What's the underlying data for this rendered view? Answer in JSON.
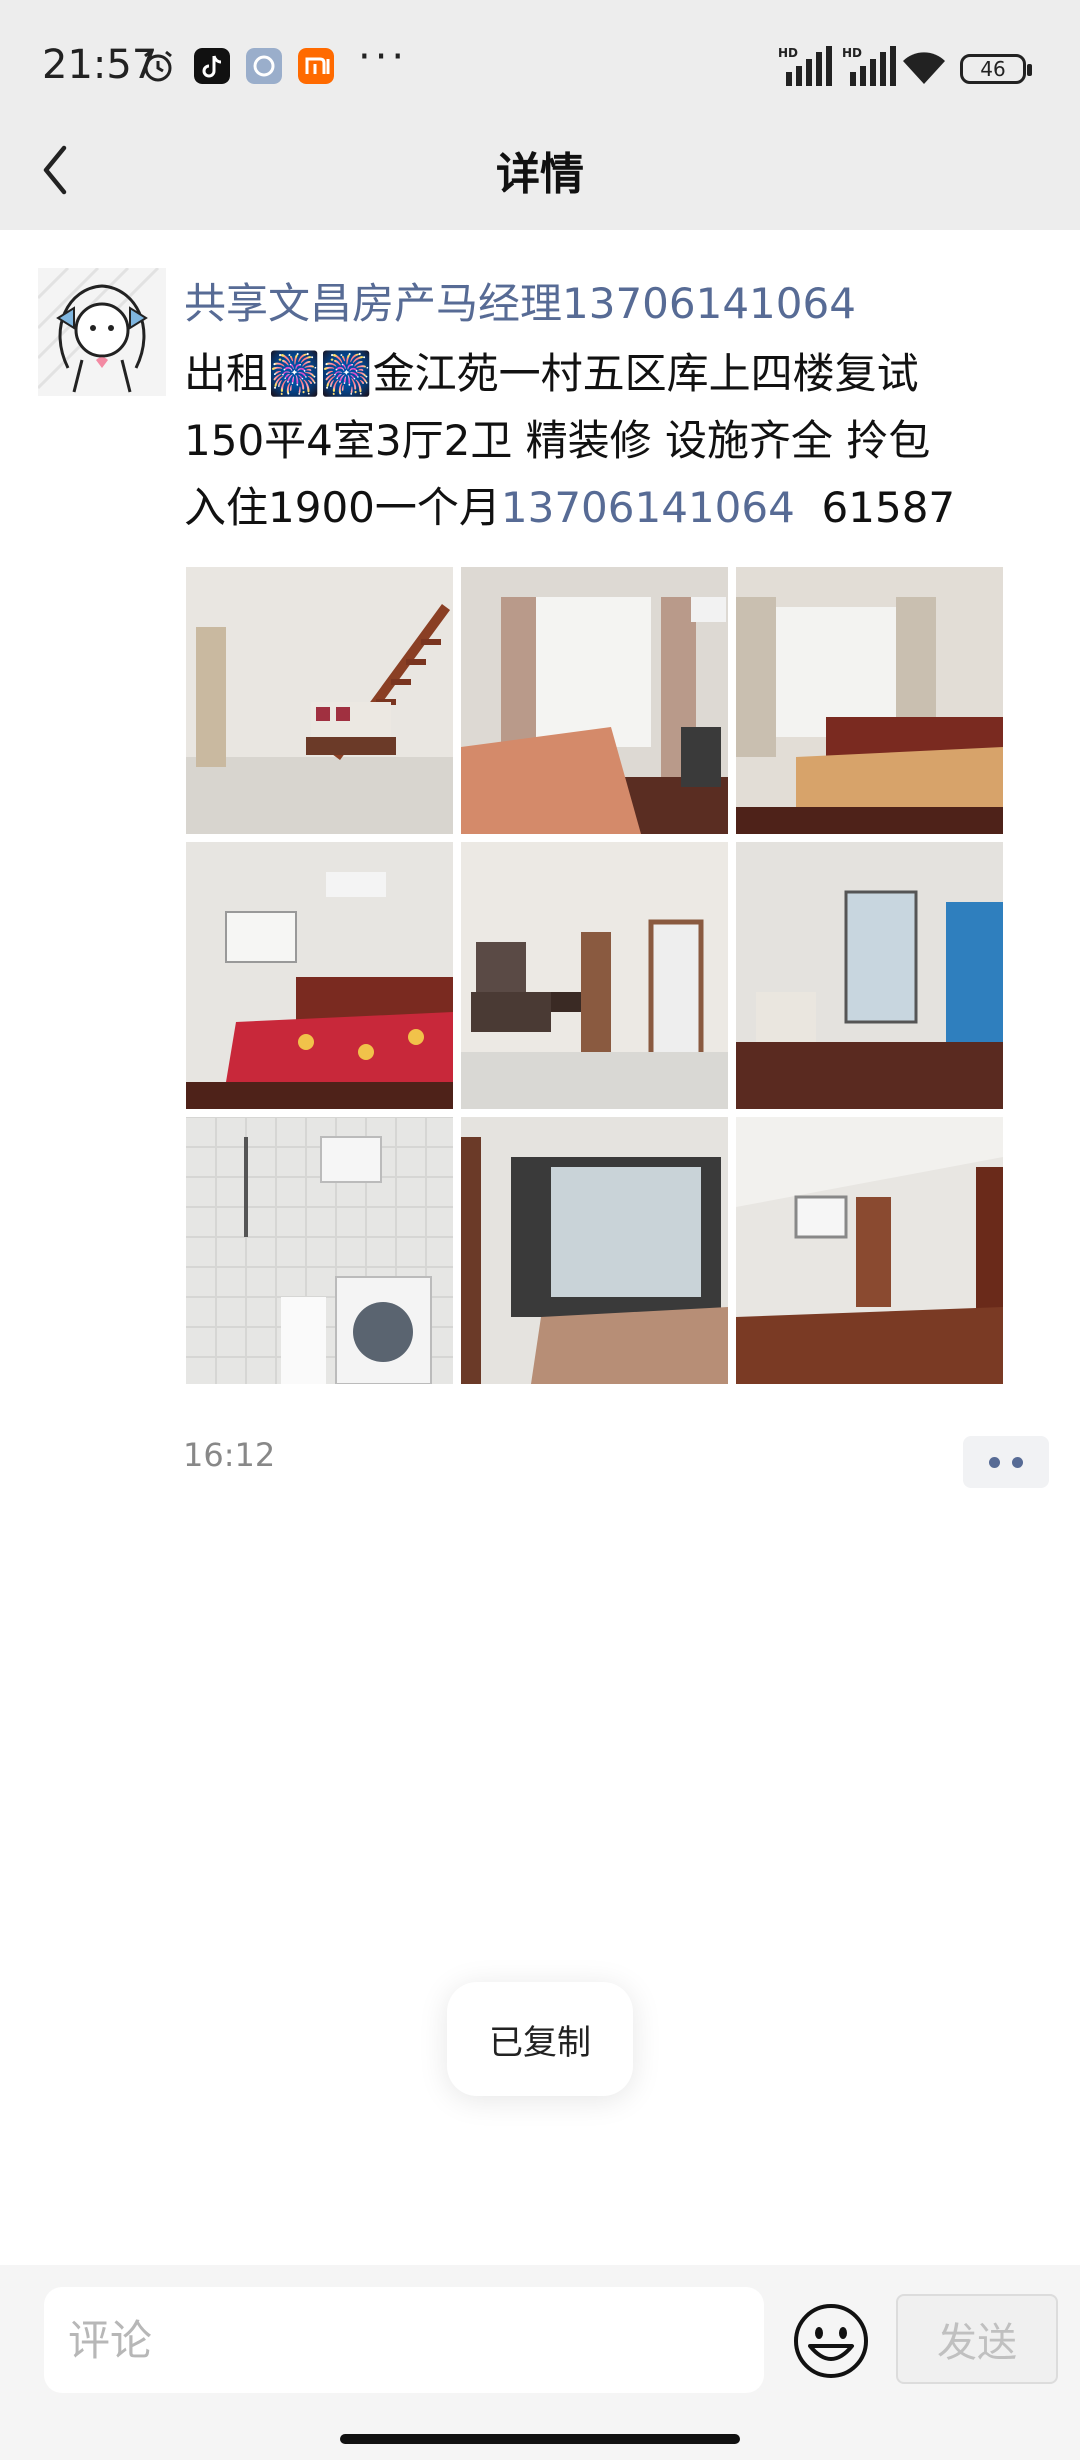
{
  "status_bar": {
    "time": "21:57",
    "icons": [
      "alarm-icon",
      "tiktok-icon",
      "app-icon",
      "xiaomi-icon"
    ],
    "more": "···",
    "network_label": "HD",
    "battery": "46"
  },
  "navbar": {
    "title": "详情"
  },
  "post": {
    "author": "共享文昌房产马经理13706141064",
    "text_line1": "出租🎆🎆金江苑一村五区库上四楼复试",
    "text_line2": "150平4室3厅2卫  精装修  设施齐全  拎包",
    "text_line3_prefix": "入住1900一个月",
    "phone": "13706141064",
    "text_line3_suffix": "  61587",
    "photos": [
      {
        "name": "living-room-stairs"
      },
      {
        "name": "bedroom-balcony"
      },
      {
        "name": "bedroom-window"
      },
      {
        "name": "bedroom-red-bed"
      },
      {
        "name": "hallway"
      },
      {
        "name": "empty-room"
      },
      {
        "name": "bathroom"
      },
      {
        "name": "kitchen-dining"
      },
      {
        "name": "attic-room"
      }
    ],
    "time": "16:12"
  },
  "toast": {
    "text": "已复制"
  },
  "comment_bar": {
    "placeholder": "评论",
    "send_label": "发送"
  },
  "colors": {
    "link": "#576b95",
    "bar_bg": "#ededed"
  }
}
